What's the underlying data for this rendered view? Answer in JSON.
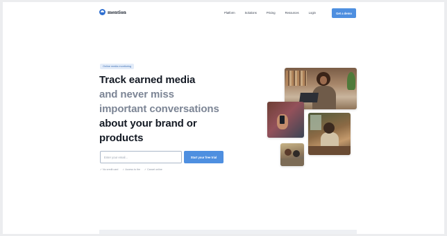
{
  "header": {
    "logo_text": "mention",
    "nav": [
      "Platform",
      "Solutions",
      "Pricing",
      "Resources",
      "Login"
    ],
    "cta_label": "Get a demo"
  },
  "hero": {
    "badge": "Online media monitoring",
    "headline": {
      "line1": "Track earned media",
      "line2": "and never miss",
      "line3": "important conversations",
      "line4": "about your brand or",
      "line5": "products"
    },
    "email_placeholder": "Enter your email...",
    "trial_label": "Start your free trial",
    "perks": [
      "No credit card",
      "Access to the",
      "Cancel online"
    ]
  },
  "colors": {
    "accent": "#4e8fe0",
    "heading": "#141a24",
    "heading_muted": "#7c8595",
    "badge_bg": "#e3ecf9"
  }
}
